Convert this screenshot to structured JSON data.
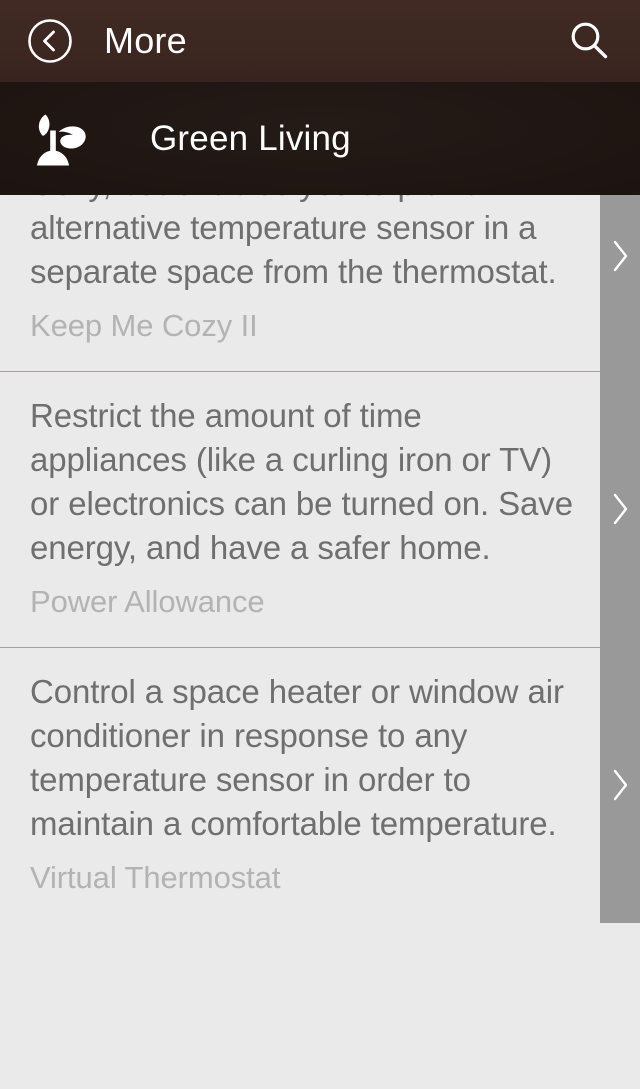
{
  "navbar": {
    "back_icon": "circle-chevron-left-icon",
    "title": "More",
    "search_icon": "search-icon"
  },
  "category": {
    "icon": "sprout-icon",
    "title": "Green Living"
  },
  "colors": {
    "navbar_bg": "#3c2721",
    "subheader_bg": "#1e1512",
    "content_bg": "#eaeaea",
    "accessory_bg": "#999999",
    "description_text": "#6f6f6f",
    "name_text": "#b3b3b3",
    "separator": "#a6a19e",
    "icon_white": "#ffffff"
  },
  "list": {
    "accessory_icon": "chevron-right-icon",
    "items": [
      {
        "description": "Cozy, but enables you to pick an alternative temperature sensor in a separate space from the thermostat.",
        "name": "Keep Me Cozy II",
        "clipped_top": true
      },
      {
        "description": "Restrict the amount of time appliances (like a curling iron or TV) or electronics can be turned on. Save energy, and have a safer home.",
        "name": "Power Allowance",
        "clipped_top": false
      },
      {
        "description": "Control a space heater or window air conditioner in response to any temperature sensor in order to maintain a comfortable temperature.",
        "name": "Virtual Thermostat",
        "clipped_top": false
      }
    ]
  }
}
